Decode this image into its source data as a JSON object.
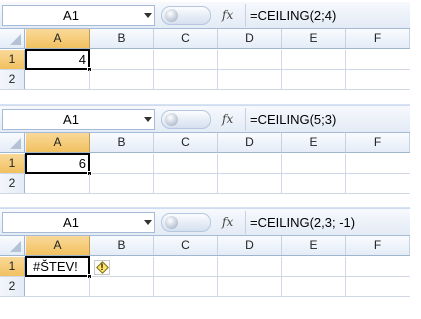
{
  "columns": [
    "A",
    "B",
    "C",
    "D",
    "E",
    "F"
  ],
  "rows": [
    "1",
    "2"
  ],
  "fx_label": "fx",
  "panels": [
    {
      "name_box": "A1",
      "formula": "=CEILING(2;4)",
      "cell_value": "4",
      "is_error": false
    },
    {
      "name_box": "A1",
      "formula": "=CEILING(5;3)",
      "cell_value": "6",
      "is_error": false
    },
    {
      "name_box": "A1",
      "formula": "=CEILING(2,3; -1)",
      "cell_value": "#ŠTEV!",
      "is_error": true,
      "error_icon": "warning-icon"
    }
  ]
}
